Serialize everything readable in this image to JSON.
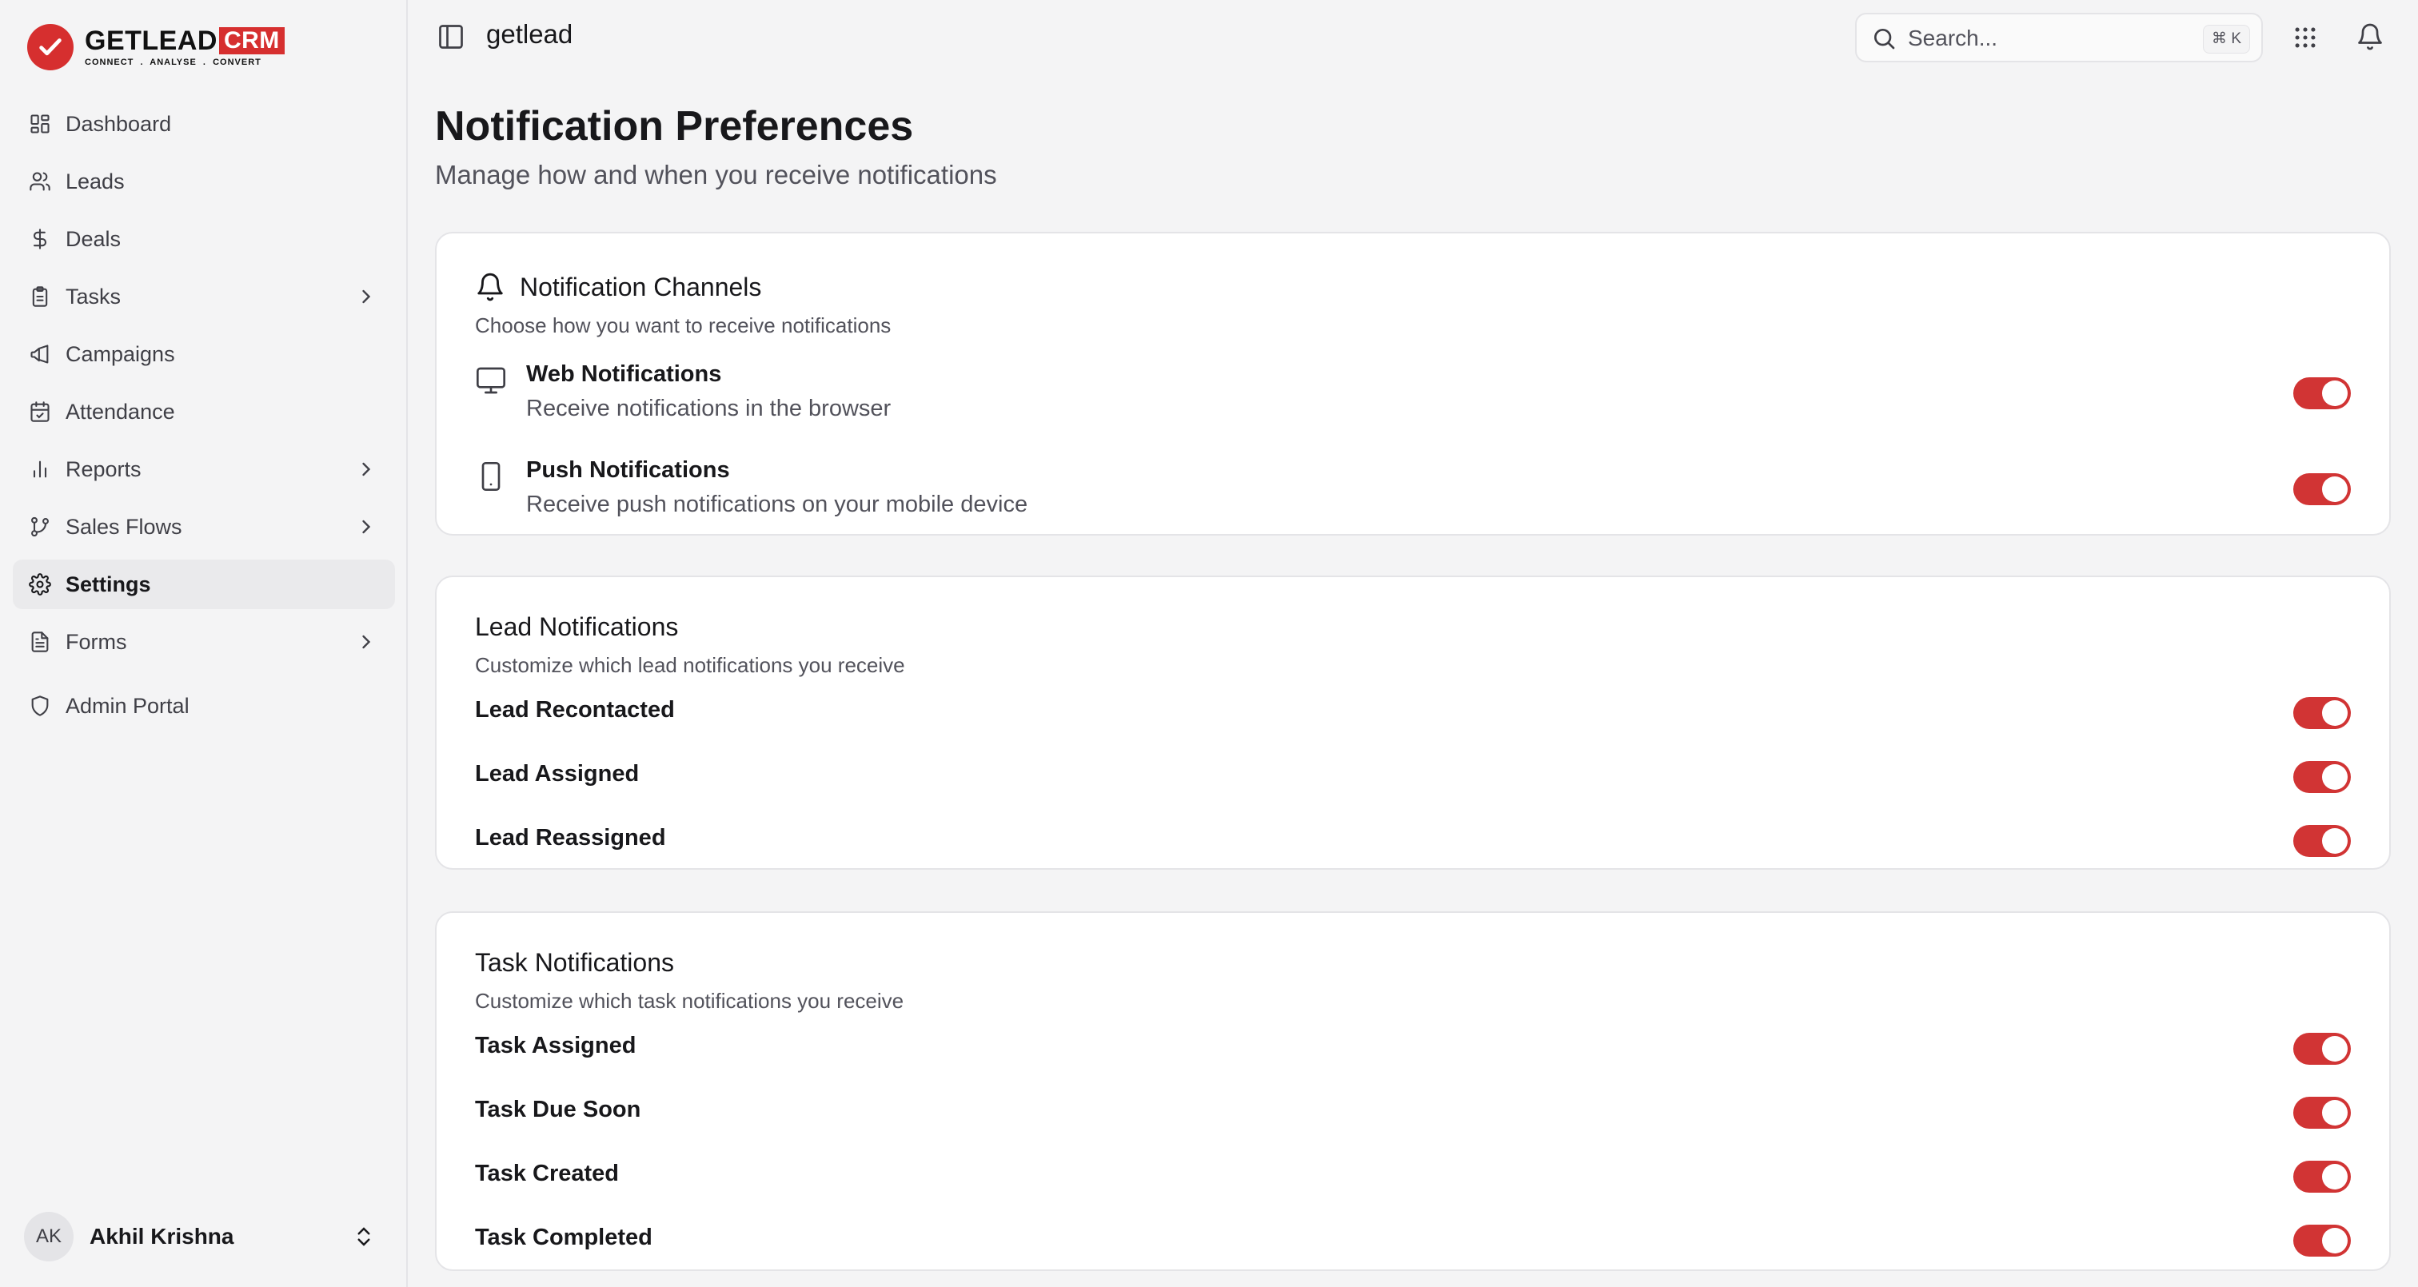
{
  "brand": {
    "name": "GETLEAD",
    "crm": "CRM",
    "tagline": "CONNECT  .  ANALYSE  .  CONVERT",
    "accent_color": "#d62f2f"
  },
  "sidebar": {
    "items": [
      {
        "label": "Dashboard",
        "icon": "grid-icon"
      },
      {
        "label": "Leads",
        "icon": "users-icon"
      },
      {
        "label": "Deals",
        "icon": "dollar-icon"
      },
      {
        "label": "Tasks",
        "icon": "clipboard-icon",
        "has_submenu": true
      },
      {
        "label": "Campaigns",
        "icon": "megaphone-icon"
      },
      {
        "label": "Attendance",
        "icon": "calendar-check-icon"
      },
      {
        "label": "Reports",
        "icon": "bar-chart-icon",
        "has_submenu": true
      },
      {
        "label": "Sales Flows",
        "icon": "git-branch-icon",
        "has_submenu": true
      },
      {
        "label": "Settings",
        "icon": "gear-icon",
        "active": true
      },
      {
        "label": "Forms",
        "icon": "file-text-icon",
        "has_submenu": true
      },
      {
        "label": "Admin Portal",
        "icon": "shield-icon"
      }
    ],
    "user": {
      "initials": "AK",
      "name": "Akhil Krishna"
    }
  },
  "header": {
    "breadcrumb": "getlead",
    "search": {
      "placeholder": "Search...",
      "shortcut": "⌘ K"
    }
  },
  "page": {
    "title": "Notification Preferences",
    "subtitle": "Manage how and when you receive notifications"
  },
  "channels": {
    "title": "Notification Channels",
    "description": "Choose how you want to receive notifications",
    "items": [
      {
        "title": "Web Notifications",
        "subtitle": "Receive notifications in the browser",
        "icon": "monitor-icon",
        "enabled": true
      },
      {
        "title": "Push Notifications",
        "subtitle": "Receive push notifications on your mobile device",
        "icon": "smartphone-icon",
        "enabled": true
      }
    ]
  },
  "lead_notifications": {
    "title": "Lead Notifications",
    "description": "Customize which lead notifications you receive",
    "items": [
      {
        "label": "Lead Recontacted",
        "enabled": true
      },
      {
        "label": "Lead Assigned",
        "enabled": true
      },
      {
        "label": "Lead Reassigned",
        "enabled": true
      }
    ]
  },
  "task_notifications": {
    "title": "Task Notifications",
    "description": "Customize which task notifications you receive",
    "items": [
      {
        "label": "Task Assigned",
        "enabled": true
      },
      {
        "label": "Task Due Soon",
        "enabled": true
      },
      {
        "label": "Task Created",
        "enabled": true
      },
      {
        "label": "Task Completed",
        "enabled": true
      }
    ]
  },
  "toggle_on_color": "#d13434"
}
